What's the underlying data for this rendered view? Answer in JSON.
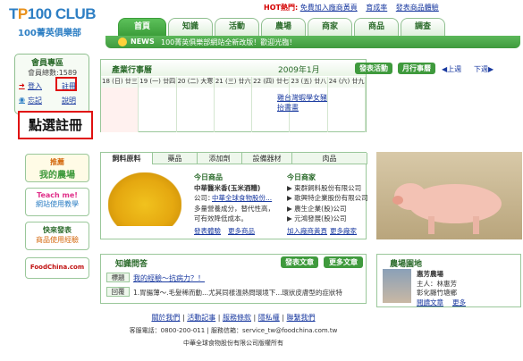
{
  "logo": {
    "line1_top": "T",
    "line1_o": "P",
    "line1_rest": "100 CLUB",
    "line2": "100菁英俱樂部"
  },
  "toplinks": {
    "hot": "HOT熱門:",
    "items": [
      "免費加入廠商黃頁",
      "育成率",
      "發表商品體驗"
    ]
  },
  "tabs": [
    "首頁",
    "知識",
    "活動",
    "農場",
    "商家",
    "商品",
    "調查"
  ],
  "news": {
    "label": "NEWS",
    "text": "100菁英俱樂部網站全新改版！歡迎光臨！"
  },
  "member": {
    "title": "會員專區",
    "count_label": "會員總數:1589",
    "login": "登入",
    "register": "註冊",
    "forgot": "忘記",
    "help": "說明"
  },
  "callout": "點選註冊",
  "side_buttons": [
    {
      "line1": "推薦",
      "line2": "我的農場"
    },
    {
      "line1": "Teach me!",
      "line2": "網站使用教學"
    },
    {
      "line1": "快來發表",
      "line2": "商品使用經驗"
    },
    {
      "line1": "FoodChina.com",
      "line2": ""
    }
  ],
  "calendar": {
    "title": "產業行事曆",
    "month": "2009年1月",
    "btn_post": "發表活動",
    "btn_month": "月行事曆",
    "prev": "上週",
    "next": "下週",
    "days": [
      "18 (日) 廿三",
      "19 (一) 廿四",
      "20 (二) 大寒",
      "21 (三) 廿六",
      "22 (四) 廿七",
      "23 (五) 廿八",
      "24 (六) 廿九"
    ],
    "event": "雞台灣蝦學女豬抬書畫"
  },
  "products": {
    "tabs": [
      "飼料原料",
      "藥品",
      "添加劑",
      "設備器材",
      "肉品"
    ],
    "today_product_label": "今日商品",
    "product_name": "中華醫米香(玉米酒糟)",
    "company_label": "公司：",
    "company": "中華全球食物股份...",
    "desc1": "多量營養成分，替代性高，",
    "desc2": "可有效降低成本。",
    "link_post": "發表體驗",
    "link_more": "更多商品",
    "today_company_label": "今日商家",
    "companies": [
      "東群飼料股份有限公司",
      "歌興特企業股份有限公司",
      "農生企業(股)公司",
      "元鴻發展(股)公司"
    ],
    "link_join": "加入廠商黃頁",
    "link_more_co": "更多廠家"
  },
  "knowledge": {
    "title": "知識問答",
    "btn_post": "發表文章",
    "btn_more": "更多文章",
    "q_tag": "標題",
    "q_text": "我的經驗～抗病力？！",
    "a_tag": "回覆",
    "a_text": "1.胃腸薄～.毛髮稀而動...尤其同樣溫熱問環境下...環狀皮膚型的症狀特"
  },
  "farm": {
    "title": "農場園地",
    "name": "惠芳農場",
    "owner": "主人：林惠芳",
    "location": "彰化縣竹塘鄉",
    "link_read": "閱讀文章",
    "link_more": "更多"
  },
  "footer": {
    "links": [
      "關於我們",
      "活動記事",
      "服務條款",
      "隱私權",
      "聯繫我們"
    ],
    "contact": "客服電話：0800-200-011 | 服務信箱：service_tw@foodchina.com.tw",
    "copyright": "中華全球食物股份有限公司版權所有"
  },
  "colors": {
    "green": "#3f9a3d",
    "link": "#1a3aa0",
    "red": "#e01010",
    "orange": "#e8911c"
  }
}
